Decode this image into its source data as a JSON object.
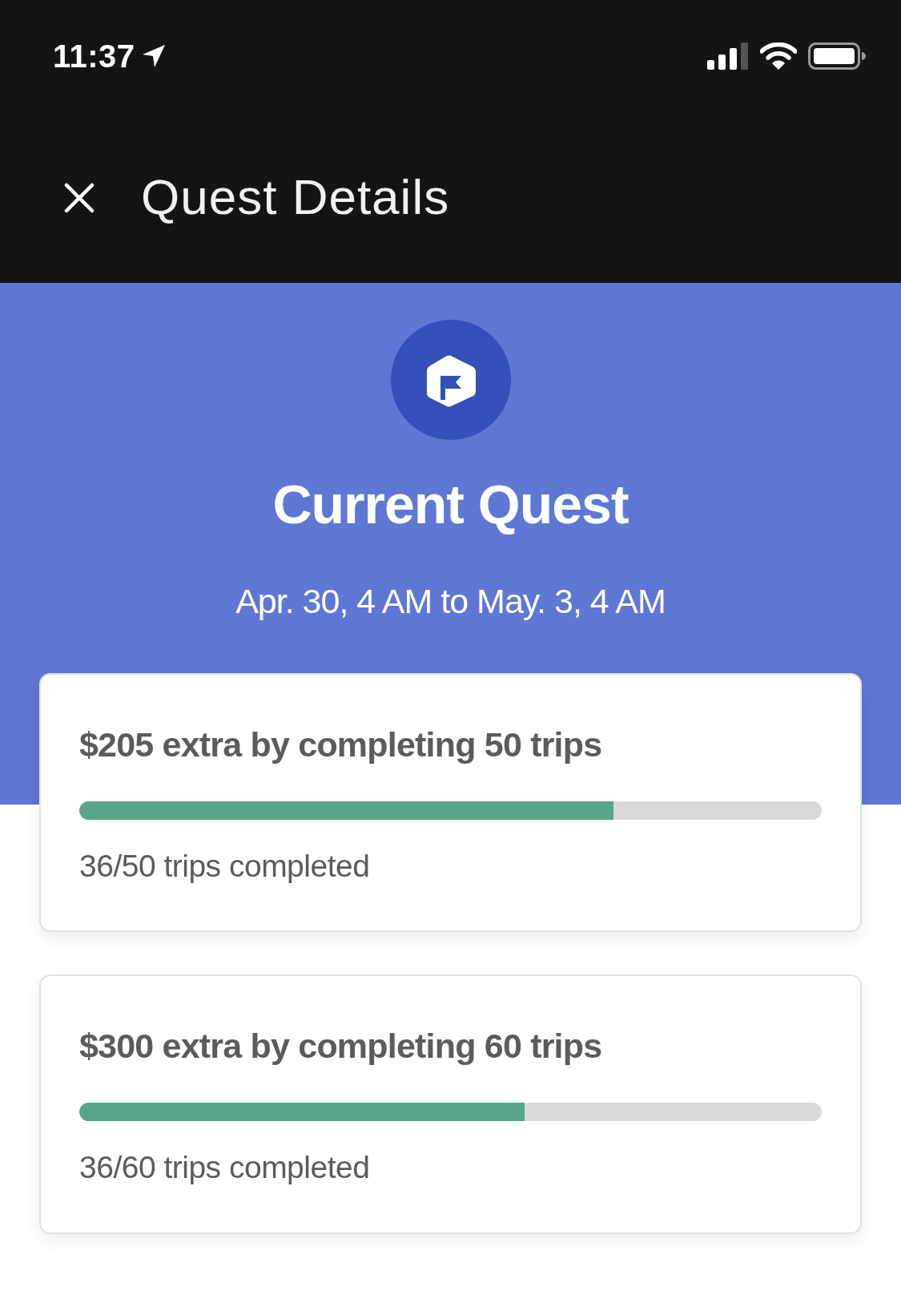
{
  "status_bar": {
    "time": "11:37"
  },
  "header": {
    "title": "Quest Details"
  },
  "hero": {
    "title": "Current Quest",
    "date_range": "Apr. 30, 4 AM to May. 3, 4 AM"
  },
  "quests": [
    {
      "title": "$205 extra by completing 50 trips",
      "level": 0.72,
      "progress_text": "36/50 trips completed"
    },
    {
      "title": "$300 extra by completing 60 trips",
      "level": 0.6,
      "progress_text": "36/60 trips completed"
    }
  ]
}
